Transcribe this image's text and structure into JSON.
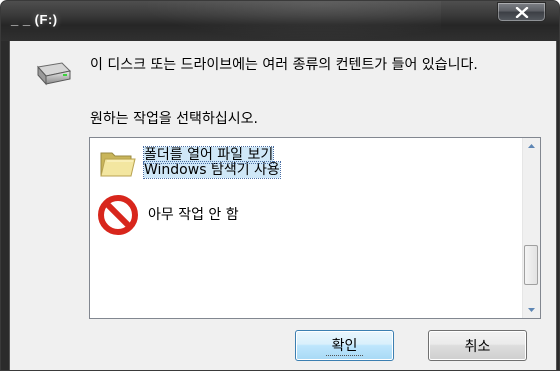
{
  "window": {
    "title": "_ _ (F:)"
  },
  "colors": {
    "titlebar": "#2b2b2b",
    "dialog_background": "#f0f0f0",
    "selection": "#cfe7f7",
    "no_icon_red": "#d8261c",
    "default_button_border": "#3c7fb1"
  },
  "dialog": {
    "drive_icon": "removable-drive-icon",
    "message": "이 디스크 또는 드라이브에는 여러 종류의 컨텐트가 들어 있습니다.",
    "prompt": "원하는 작업을 선택하십시오."
  },
  "options": [
    {
      "icon": "folder-icon",
      "line1": "폴더를 열어 파일 보기",
      "line2": "Windows 탐색기 사용",
      "selected": true
    },
    {
      "icon": "no-entry-icon",
      "line1": "아무 작업 안 함",
      "selected": false
    }
  ],
  "buttons": {
    "ok": "확인",
    "cancel": "취소"
  }
}
